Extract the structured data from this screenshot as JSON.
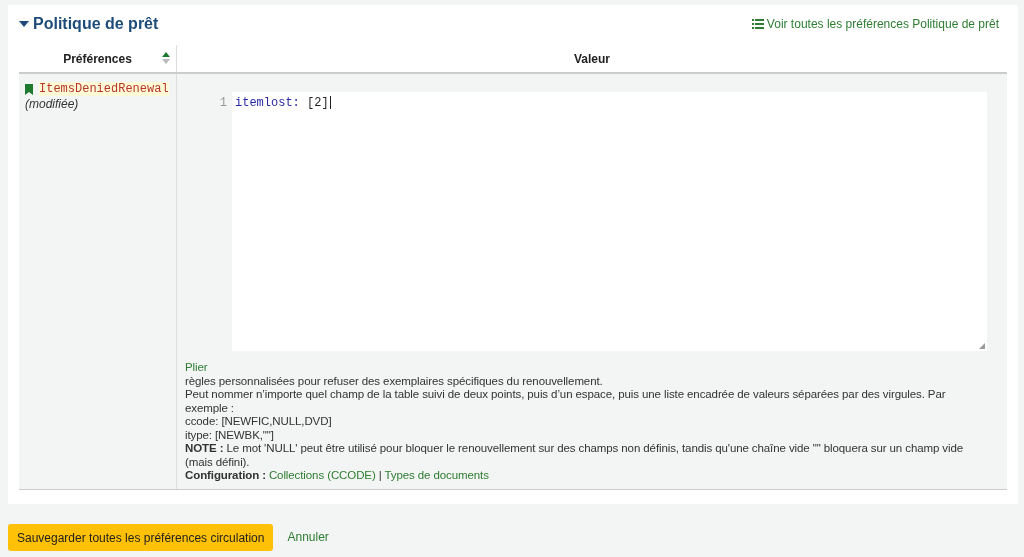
{
  "section": {
    "title": "Politique de prêt",
    "view_all": "Voir toutes les préférences Politique de prêt"
  },
  "table": {
    "columns": [
      "Préférences",
      "Valeur"
    ],
    "rows": [
      {
        "name": "ItemsDeniedRenewal",
        "status": "(modifiée)",
        "editor": {
          "line_number": "1",
          "key": "itemlost:",
          "value": "[2]"
        },
        "collapse": "Plier",
        "description": [
          "règles personnalisées pour refuser des exemplaires spécifiques du renouvellement.",
          "Peut nommer n’importe quel champ de la table suivi de deux points, puis d’un espace, puis une liste encadrée de valeurs séparées par des virgules. Par exemple :",
          "ccode: [NEWFIC,NULL,DVD]",
          "itype: [NEWBK,\"\"]",
          "**NOTE :** Le mot 'NULL' peut être utilisé pour bloquer le renouvellement sur des champs non définis, tandis qu'une chaîne vide \"\" bloquera sur un champ vide (mais défini)."
        ],
        "configuration": {
          "label": "Configuration :",
          "links": [
            "Collections (CCODE)",
            "Types de documents"
          ],
          "separator": "|"
        }
      }
    ]
  },
  "buttons": {
    "save": "Sauvegarder toutes les préférences circulation",
    "cancel": "Annuler"
  }
}
